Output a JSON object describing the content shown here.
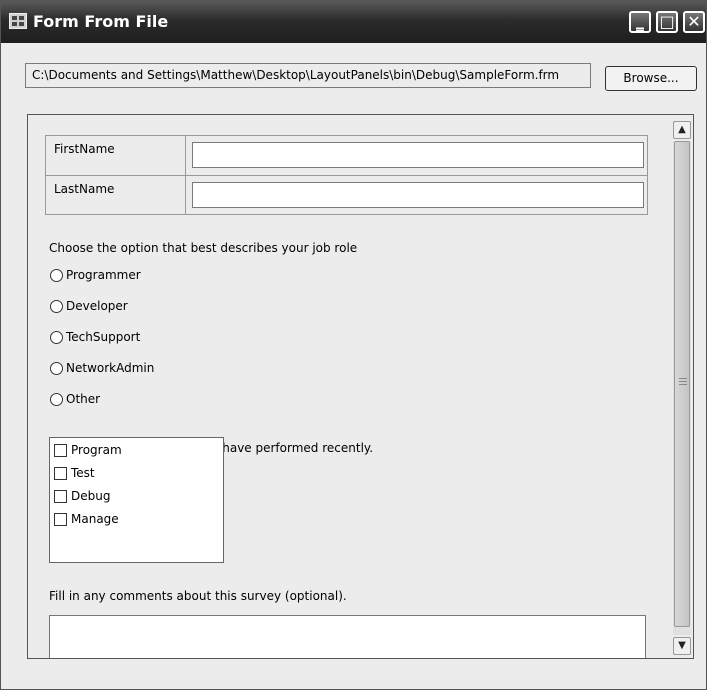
{
  "window": {
    "title": "Form From File",
    "controls": {
      "minimize": "‗",
      "maximize": "□",
      "close": "✕"
    }
  },
  "file": {
    "path": "C:\\Documents and Settings\\Matthew\\Desktop\\LayoutPanels\\bin\\Debug\\SampleForm.frm",
    "browse_label": "Browse..."
  },
  "form": {
    "fields": [
      {
        "label": "FirstName",
        "value": ""
      },
      {
        "label": "LastName",
        "value": ""
      }
    ],
    "job_question": "Choose the option that best describes your job role",
    "job_options": [
      "Programmer",
      "Developer",
      "TechSupport",
      "NetworkAdmin",
      "Other"
    ],
    "activities_question": "Choose all the activities you have performed recently.",
    "activities": [
      "Program",
      "Test",
      "Debug",
      "Manage"
    ],
    "comments_prompt": "Fill in any comments about this survey (optional).",
    "comments_value": ""
  },
  "scrollbar": {
    "up_arrow": "▲",
    "down_arrow": "▼"
  },
  "icons": [
    "app-icon",
    "minimize-icon",
    "maximize-icon",
    "close-icon",
    "scroll-up-icon",
    "scroll-down-icon"
  ]
}
